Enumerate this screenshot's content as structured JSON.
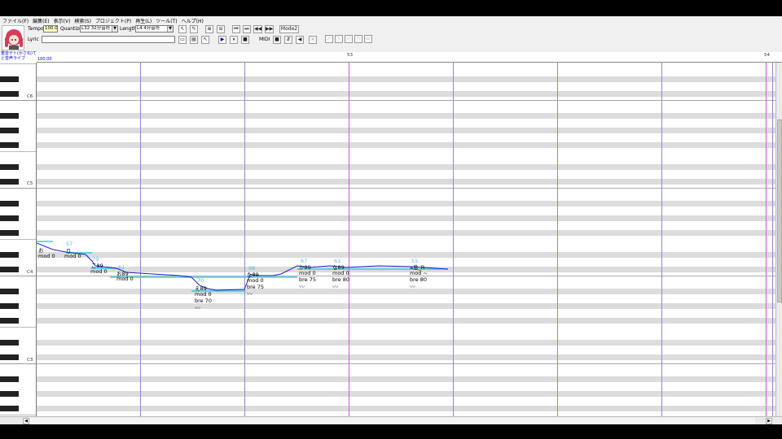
{
  "menu": [
    {
      "label": "ファイル(F)"
    },
    {
      "label": "編集(E)"
    },
    {
      "label": "表示(V)"
    },
    {
      "label": "検索(S)"
    },
    {
      "label": "プロジェクト(P)"
    },
    {
      "label": "再生(L)"
    },
    {
      "label": "ツール(T)"
    },
    {
      "label": "ヘルプ(H)"
    }
  ],
  "toolbar": {
    "tempo_label": "Tempo",
    "tempo_value": "100.0",
    "quantize_label": "Quantize",
    "quantize_value": "L32 32分音符",
    "length_label": "Length",
    "length_value": "L4 4分音符",
    "lyric_label": "Lyric",
    "lyric_value": "",
    "mode_label": "Mode2",
    "midi_label": "MIDI",
    "zoom_in_glyph": "🔍",
    "zoom_out_glyph": "🔍"
  },
  "ruler": {
    "bars": [
      "53",
      "54"
    ]
  },
  "track": {
    "singer": "重音テト(かさね)てと音声ライブ",
    "tempo_mark": "100.00"
  },
  "keyboard": {
    "octave_labels": [
      "C6",
      "C5",
      "C4",
      "C3"
    ]
  },
  "notes": [
    {
      "lyric": "お",
      "vel": "",
      "params": [
        "mod 0"
      ]
    },
    {
      "lyric": "り",
      "vel": "57",
      "params": [
        "mod 0"
      ]
    },
    {
      "lyric": "こ89",
      "vel": "79",
      "params": [
        "mod 0"
      ]
    },
    {
      "lyric": "お89",
      "vel": "61",
      "params": [
        "mod 0"
      ]
    },
    {
      "lyric": "え89",
      "vel": "70",
      "params": [
        "mod 0",
        "bre 70"
      ],
      "vib": "〰"
    },
    {
      "lyric": "た89",
      "vel": "68",
      "params": [
        "mod 0",
        "bre 75"
      ],
      "vib": "〰"
    },
    {
      "lyric": "か89",
      "vel": "67",
      "params": [
        "mod 0",
        "bre 75"
      ],
      "vib": "〰"
    },
    {
      "lyric": "な89",
      "vel": "61",
      "params": [
        "mod 0",
        "bre 80"
      ],
      "vib": "〰"
    },
    {
      "lyric": "a息_R",
      "vel": "55",
      "params": [
        "mod ~",
        "bre 80"
      ],
      "vib": "〰"
    }
  ],
  "colors": {
    "pitch_line": "#2020c0",
    "note_bar": "#40c8e8",
    "bar_line": "#8c8cc4",
    "playhead": "#c060d0",
    "black_key": "#222222",
    "row_shade": "#dcdcdc"
  },
  "icons": [
    "arrow-tool-icon",
    "pencil-icon",
    "zoom-in-icon",
    "zoom-out-icon",
    "rewind-icon",
    "forward-icon",
    "play-icon",
    "stop-icon"
  ]
}
